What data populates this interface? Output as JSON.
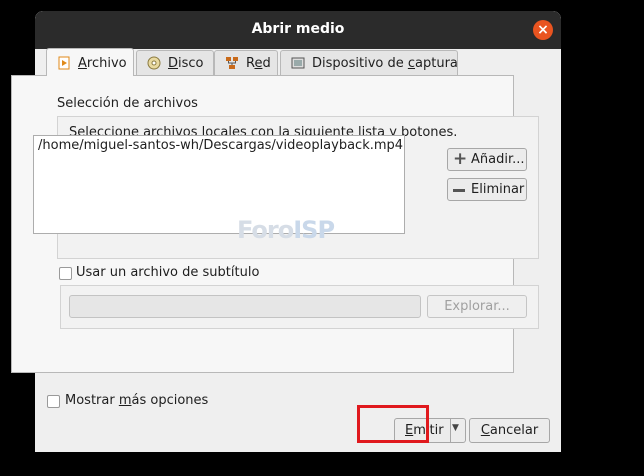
{
  "dialog": {
    "title": "Abrir medio",
    "close_icon": "close-icon"
  },
  "tabs": [
    {
      "label": "Archivo",
      "icon": "file-icon",
      "active": true
    },
    {
      "label": "Disco",
      "icon": "disc-icon",
      "active": false
    },
    {
      "label": "Red",
      "icon": "network-icon",
      "active": false
    },
    {
      "label": "Dispositivo de captura",
      "icon": "capture-device-icon",
      "active": false
    }
  ],
  "file_selection": {
    "group_label": "Selección de archivos",
    "instructions": "Seleccione archivos locales con la siguiente lista y botones.",
    "files": [
      "/home/miguel-santos-wh/Descargas/videoplayback.mp4"
    ],
    "add_button": "Añadir...",
    "remove_button": "Eliminar"
  },
  "subtitle": {
    "checkbox_label": "Usar un archivo de subtítulo",
    "checked": false,
    "path_value": "",
    "browse_button": "Explorar..."
  },
  "footer": {
    "more_options_label": "Mostrar más opciones",
    "more_options_checked": false,
    "emit_button": "Emitir",
    "cancel_button": "Cancelar"
  },
  "watermark": {
    "part1": "Foro",
    "part2": "ISP"
  },
  "colors": {
    "titlebar": "#2b2b2b",
    "close": "#e95420",
    "highlight": "#e0191d"
  }
}
